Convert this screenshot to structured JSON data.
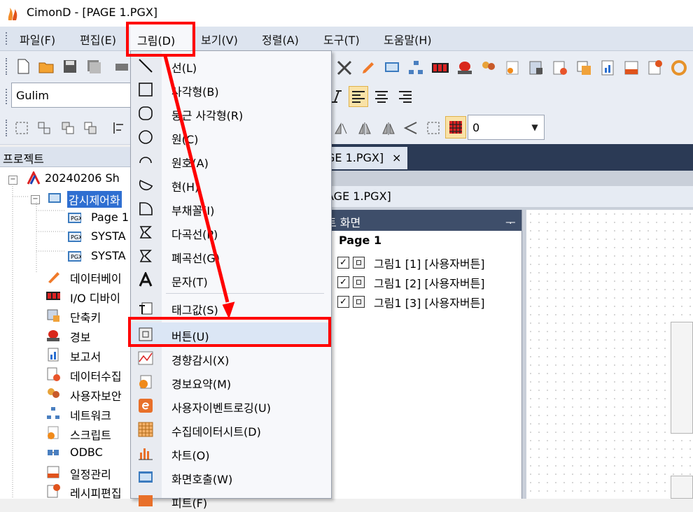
{
  "window": {
    "title": "CimonD - [PAGE 1.PGX]"
  },
  "menubar": {
    "items": [
      "파일(F)",
      "편집(E)",
      "그림(D)",
      "보기(V)",
      "정렬(A)",
      "도구(T)",
      "도움말(H)"
    ]
  },
  "toolbar": {
    "font_name": "Gulim",
    "zoom_value": "0"
  },
  "project": {
    "header": "프로젝트",
    "root": "20240206 Sh",
    "monitor": "감시제어화",
    "pages": [
      "Page 1",
      "SYSTA",
      "SYSTA"
    ],
    "items": [
      "데이터베이",
      "I/O 디바이",
      "단축키",
      "경보",
      "보고서",
      "데이터수집",
      "사용자보안",
      "네트워크",
      "스크립트",
      "ODBC",
      "일정관리",
      "레시피편집"
    ]
  },
  "document": {
    "tab_label": "GE 1.PGX]",
    "tab_close": "×",
    "inner_title": "AGE 1.PGX]"
  },
  "layer_panel": {
    "header": "트 화면",
    "pin": "ᅮ",
    "page_label": "Page 1",
    "rows": [
      "그림1 [1] [사용자버튼]",
      "그림1 [2] [사용자버튼]",
      "그림1 [3] [사용자버튼]"
    ]
  },
  "dropdown": {
    "items": [
      {
        "label": "선(L)",
        "icon": "line-icon"
      },
      {
        "label": "사각형(B)",
        "icon": "rectangle-icon"
      },
      {
        "label": "둥근 사각형(R)",
        "icon": "rounded-rectangle-icon"
      },
      {
        "label": "원(C)",
        "icon": "circle-icon"
      },
      {
        "label": "원호(A)",
        "icon": "arc-icon"
      },
      {
        "label": "현(H)",
        "icon": "chord-icon"
      },
      {
        "label": "부채꼴(I)",
        "icon": "pie-icon"
      },
      {
        "label": "다곡선(P)",
        "icon": "polyline-icon"
      },
      {
        "label": "폐곡선(G)",
        "icon": "polygon-icon"
      },
      {
        "label": "문자(T)",
        "icon": "text-icon"
      },
      {
        "label": "태그값(S)",
        "icon": "tag-value-icon"
      },
      {
        "label": "버튼(U)",
        "icon": "button-icon"
      },
      {
        "label": "경향감시(X)",
        "icon": "trend-icon"
      },
      {
        "label": "경보요약(M)",
        "icon": "alarm-summary-icon"
      },
      {
        "label": "사용자이벤트로깅(U)",
        "icon": "event-log-icon"
      },
      {
        "label": "수집데이터시트(D)",
        "icon": "data-sheet-icon"
      },
      {
        "label": "차트(O)",
        "icon": "chart-icon"
      },
      {
        "label": "화면호출(W)",
        "icon": "screen-call-icon"
      },
      {
        "label": "피트(F)",
        "icon": "fit-icon"
      }
    ]
  },
  "colors": {
    "highlight": "#ff0000",
    "menubar": "#dde4ef",
    "tabstrip": "#2b3a55"
  }
}
